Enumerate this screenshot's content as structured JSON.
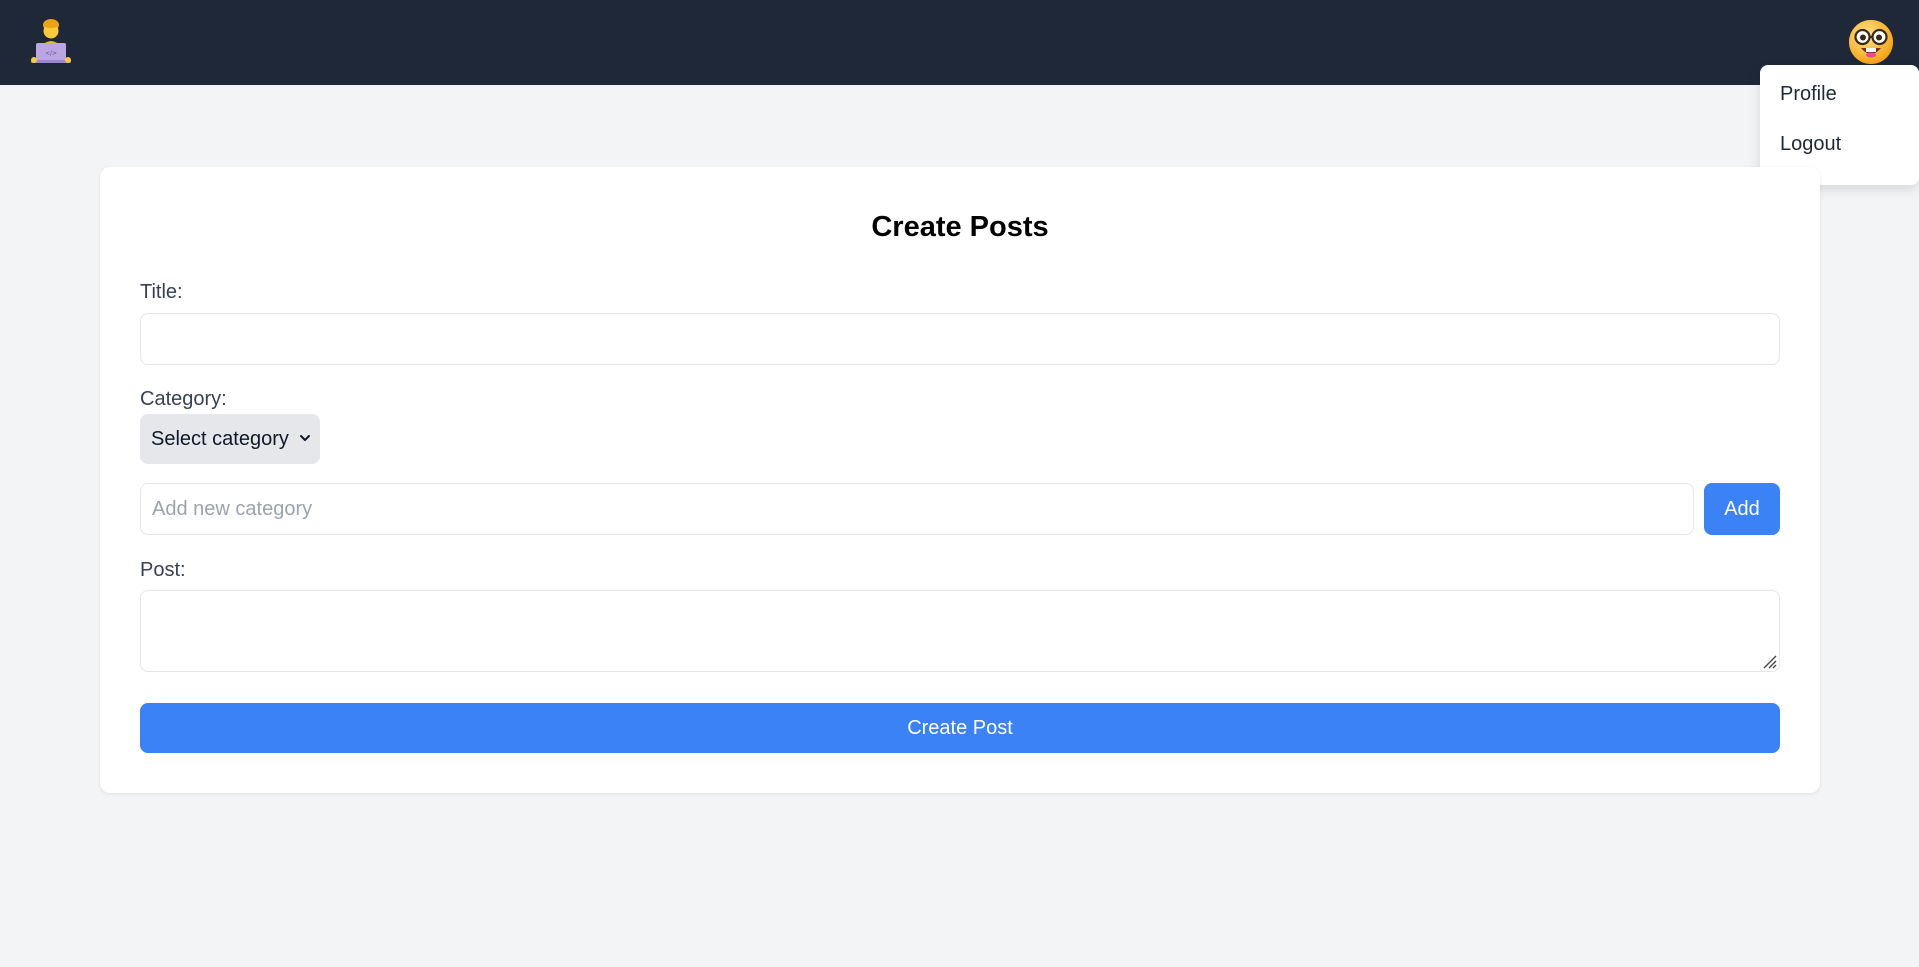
{
  "navbar": {
    "logo_icon": "technologist-emoji-icon",
    "avatar_icon": "nerd-face-emoji-icon"
  },
  "user_menu": {
    "items": [
      {
        "label": "Profile"
      },
      {
        "label": "Logout"
      }
    ]
  },
  "form": {
    "heading": "Create Posts",
    "title_label": "Title:",
    "title_value": "",
    "category_label": "Category:",
    "category_selected": "Select category",
    "new_category_placeholder": "Add new category",
    "add_label": "Add",
    "post_label": "Post:",
    "post_value": "",
    "submit_label": "Create Post"
  },
  "colors": {
    "navbar_bg": "#1f2839",
    "page_bg": "#f3f4f6",
    "primary": "#3b82f6",
    "select_bg": "#e5e7eb"
  }
}
